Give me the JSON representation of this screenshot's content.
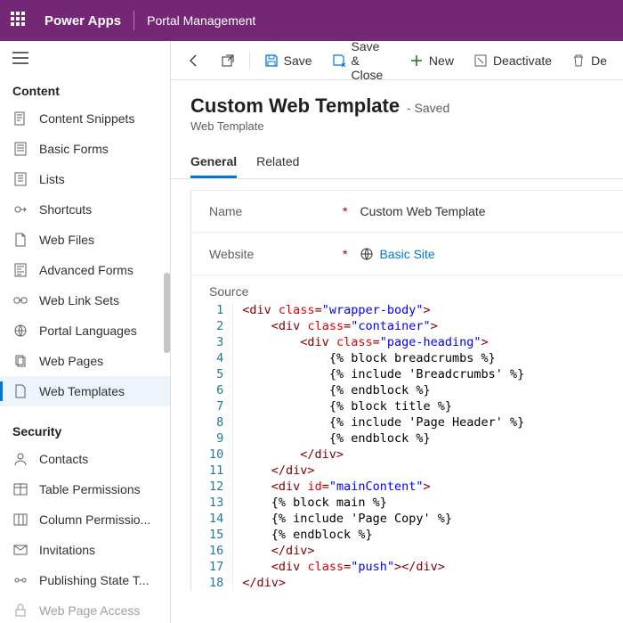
{
  "topbar": {
    "brand": "Power Apps",
    "portal": "Portal Management"
  },
  "sidebar": {
    "group1": "Content",
    "items1": [
      {
        "label": "Content Snippets"
      },
      {
        "label": "Basic Forms"
      },
      {
        "label": "Lists"
      },
      {
        "label": "Shortcuts"
      },
      {
        "label": "Web Files"
      },
      {
        "label": "Advanced Forms"
      },
      {
        "label": "Web Link Sets"
      },
      {
        "label": "Portal Languages"
      },
      {
        "label": "Web Pages"
      },
      {
        "label": "Web Templates"
      }
    ],
    "group2": "Security",
    "items2": [
      {
        "label": "Contacts"
      },
      {
        "label": "Table Permissions"
      },
      {
        "label": "Column Permissio..."
      },
      {
        "label": "Invitations"
      },
      {
        "label": "Publishing State T..."
      },
      {
        "label": "Web Page Access"
      }
    ]
  },
  "commands": {
    "save": "Save",
    "saveClose": "Save & Close",
    "new": "New",
    "deactivate": "Deactivate",
    "delete": "De"
  },
  "header": {
    "title": "Custom Web Template",
    "suffix": "- Saved",
    "subtitle": "Web Template"
  },
  "tabs": {
    "general": "General",
    "related": "Related"
  },
  "form": {
    "nameLabel": "Name",
    "nameValue": "Custom Web Template",
    "websiteLabel": "Website",
    "websiteValue": "Basic Site",
    "sourceLabel": "Source"
  },
  "code": {
    "lines": [
      {
        "n": "1",
        "indent": 0,
        "type": "open",
        "tag": "div",
        "attr": "class",
        "val": "wrapper-body"
      },
      {
        "n": "2",
        "indent": 1,
        "type": "open",
        "tag": "div",
        "attr": "class",
        "val": "container"
      },
      {
        "n": "3",
        "indent": 2,
        "type": "open",
        "tag": "div",
        "attr": "class",
        "val": "page-heading"
      },
      {
        "n": "4",
        "indent": 3,
        "type": "txt",
        "text": "{% block breadcrumbs %}"
      },
      {
        "n": "5",
        "indent": 3,
        "type": "txt",
        "text": "{% include 'Breadcrumbs' %}"
      },
      {
        "n": "6",
        "indent": 3,
        "type": "txt",
        "text": "{% endblock %}"
      },
      {
        "n": "7",
        "indent": 3,
        "type": "txt",
        "text": "{% block title %}"
      },
      {
        "n": "8",
        "indent": 3,
        "type": "txt",
        "text": "{% include 'Page Header' %}"
      },
      {
        "n": "9",
        "indent": 3,
        "type": "txt",
        "text": "{% endblock %}"
      },
      {
        "n": "10",
        "indent": 2,
        "type": "close",
        "tag": "div"
      },
      {
        "n": "11",
        "indent": 1,
        "type": "close",
        "tag": "div"
      },
      {
        "n": "12",
        "indent": 1,
        "type": "open",
        "tag": "div",
        "attr": "id",
        "val": "mainContent"
      },
      {
        "n": "13",
        "indent": 1,
        "type": "txt",
        "text": "{% block main %}"
      },
      {
        "n": "14",
        "indent": 1,
        "type": "txt",
        "text": "{% include 'Page Copy' %}"
      },
      {
        "n": "15",
        "indent": 1,
        "type": "txt",
        "text": "{% endblock %}"
      },
      {
        "n": "16",
        "indent": 1,
        "type": "close",
        "tag": "div"
      },
      {
        "n": "17",
        "indent": 1,
        "type": "openclose",
        "tag": "div",
        "attr": "class",
        "val": "push"
      },
      {
        "n": "18",
        "indent": 0,
        "type": "close",
        "tag": "div"
      }
    ]
  }
}
